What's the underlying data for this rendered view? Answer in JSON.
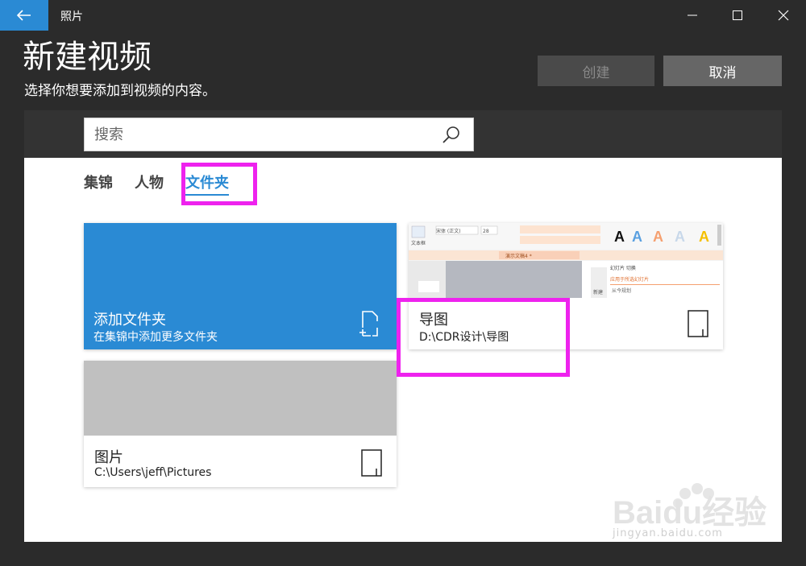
{
  "titlebar": {
    "app_name": "照片"
  },
  "header": {
    "title": "新建视频",
    "subtitle": "选择你想要添加到视频的内容。",
    "create_label": "创建",
    "cancel_label": "取消"
  },
  "search": {
    "placeholder": "搜索"
  },
  "tabs": [
    {
      "label": "集锦",
      "active": false
    },
    {
      "label": "人物",
      "active": false
    },
    {
      "label": "文件夹",
      "active": true
    }
  ],
  "cards": {
    "add": {
      "name": "添加文件夹",
      "desc": "在集锦中添加更多文件夹"
    },
    "daotu": {
      "name": "导图",
      "path": "D:\\CDR设计\\导图"
    },
    "pictures": {
      "name": "图片",
      "path": "C:\\Users\\jeff\\Pictures"
    }
  },
  "thumbnail_text": {
    "font_name": "宋体 (正文)",
    "font_size": "28",
    "text_box": "文本框",
    "tab_title": "演示文稿4 *",
    "new_slide": "新建",
    "panel_title": "幻灯片 切换",
    "panel_item1": "应用于所选幻灯片",
    "panel_item2": "从今规划"
  },
  "watermark": {
    "brand": "Baidu经验",
    "url": "jingyan.baidu.com"
  },
  "colors": {
    "accent": "#2a8ad4",
    "highlight": "#ee22ee",
    "chrome": "#2b2b2b"
  }
}
